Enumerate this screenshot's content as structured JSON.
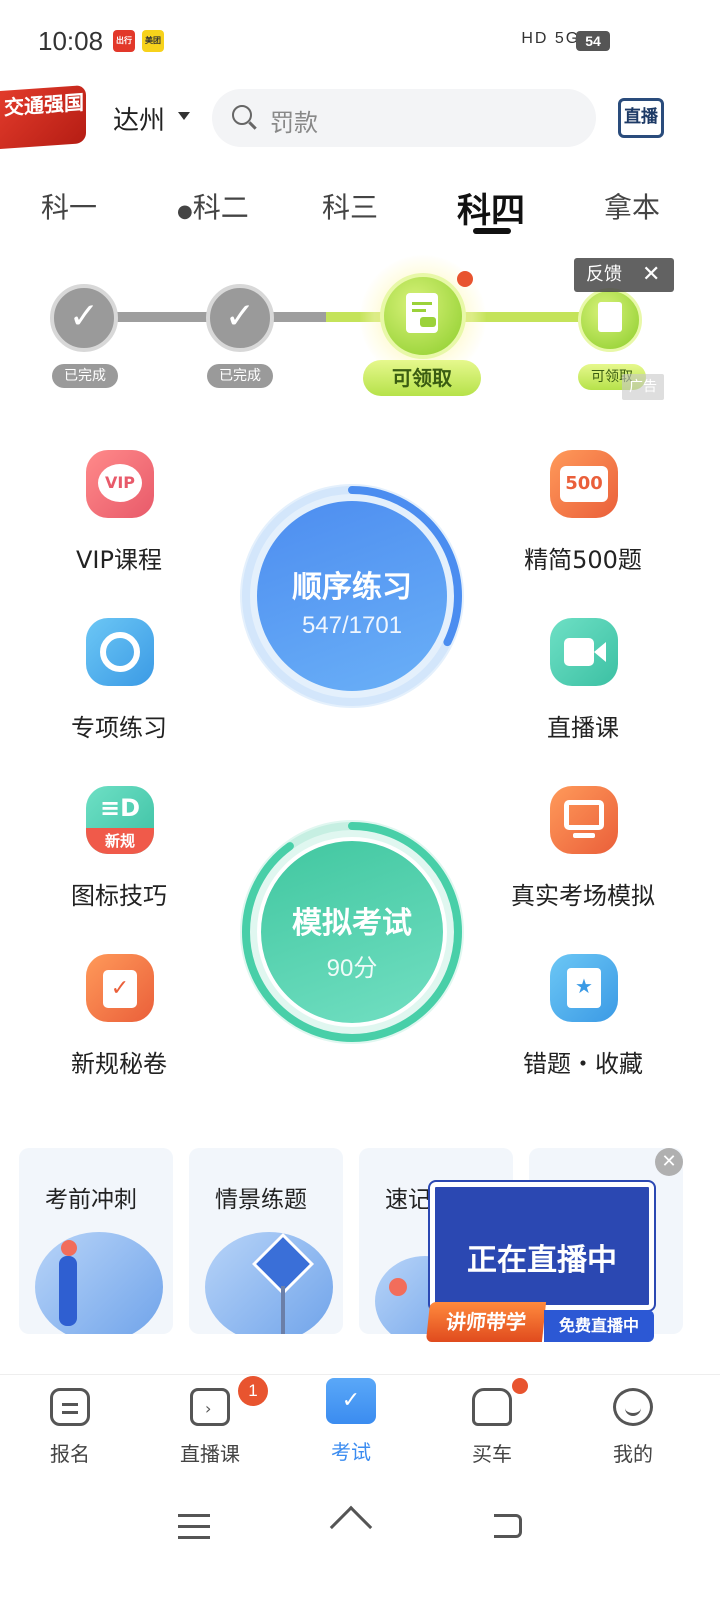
{
  "status_bar": {
    "time": "10:08",
    "app_icon_1": "出行",
    "app_icon_2": "美团",
    "network": "HD 5G 4G",
    "battery": "54"
  },
  "header": {
    "logo_text": "交通强国",
    "city": "达州",
    "search_placeholder": "罚款",
    "live_icon_label": "直播"
  },
  "tabs": [
    "科一",
    "科二",
    "科三",
    "科四",
    "拿本"
  ],
  "progress": {
    "step1_label": "已完成",
    "step2_label": "已完成",
    "step3_label": "可领取",
    "step4_label": "可领取",
    "feedback": "反馈",
    "ad_tag": "广告"
  },
  "features_left": [
    {
      "label": "VIP课程",
      "icon": "vip-icon",
      "color": "#f06a6a"
    },
    {
      "label": "专项练习",
      "icon": "target-icon",
      "color": "#48aee8"
    },
    {
      "label": "图标技巧",
      "icon": "new-rules-icon",
      "color": "#4fd0b3",
      "icon_text": "新规"
    },
    {
      "label": "新规秘卷",
      "icon": "clipboard-check-icon",
      "color": "#f07a43"
    }
  ],
  "features_right": [
    {
      "label": "精简500题",
      "icon": "500-icon",
      "color": "#f07a43",
      "icon_text": "500"
    },
    {
      "label": "直播课",
      "icon": "video-camera-icon",
      "color": "#4fd0b3"
    },
    {
      "label": "真实考场模拟",
      "icon": "monitor-icon",
      "color": "#f07a43"
    },
    {
      "label": "错题・收藏",
      "icon": "bookmark-star-icon",
      "color": "#48aee8"
    }
  ],
  "practice": {
    "title": "顺序练习",
    "progress_text": "547/1701",
    "done": 547,
    "total": 1701
  },
  "mock_exam": {
    "title": "模拟考试",
    "score_text": "90分",
    "score": 90
  },
  "cards": [
    {
      "title": "考前冲刺"
    },
    {
      "title": "情景练题"
    },
    {
      "title": "速记"
    }
  ],
  "live_popup": {
    "title": "正在直播中",
    "ribbon_left": "讲师带学",
    "ribbon_right": "免费直播中"
  },
  "bottom_nav": [
    {
      "label": "报名",
      "icon": "register-icon"
    },
    {
      "label": "直播课",
      "icon": "tv-icon",
      "badge": "1"
    },
    {
      "label": "考试",
      "icon": "exam-folder-icon",
      "active": true
    },
    {
      "label": "买车",
      "icon": "car-icon"
    },
    {
      "label": "我的",
      "icon": "smile-icon"
    }
  ],
  "colors": {
    "accent_blue": "#3b8cf0",
    "practice_blue": "#5a92ef",
    "exam_green": "#48cfa8",
    "reward_green": "#b6e24a",
    "badge_red": "#e8542f"
  }
}
